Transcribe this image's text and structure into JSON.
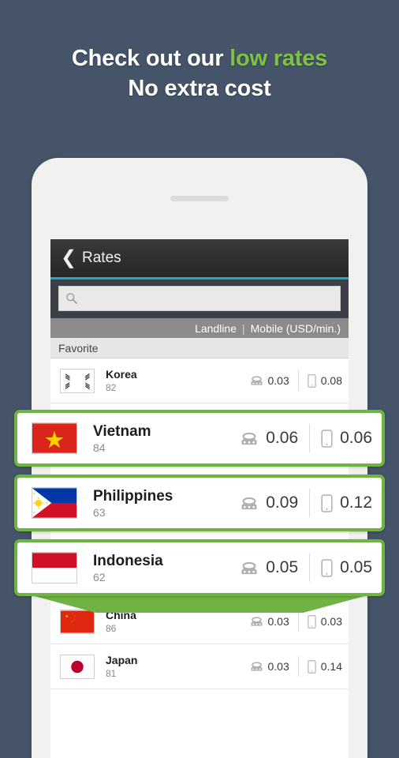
{
  "headline": {
    "line1_prefix": "Check out our ",
    "line1_accent": "low rates",
    "line2": "No extra cost",
    "accent_color": "#7dc242"
  },
  "app": {
    "back_icon": "back-chevron-icon",
    "title": "Rates",
    "accent_bar_color": "#1fa9c4",
    "search": {
      "icon": "search-icon",
      "value": "",
      "placeholder": ""
    },
    "columns": {
      "landline": "Landline",
      "separator": "|",
      "mobile": "Mobile (USD/min.)"
    },
    "section_title": "Favorite"
  },
  "rows": [
    {
      "country": "Korea",
      "code": "82",
      "landline": "0.03",
      "mobile": "0.08",
      "flag": "kr",
      "highlighted": false
    },
    {
      "country": "China",
      "code": "86",
      "landline": "0.03",
      "mobile": "0.03",
      "flag": "cn",
      "highlighted": false
    },
    {
      "country": "Japan",
      "code": "81",
      "landline": "0.03",
      "mobile": "0.14",
      "flag": "jp",
      "highlighted": false
    }
  ],
  "highlighted_rows": [
    {
      "country": "Vietnam",
      "code": "84",
      "landline": "0.06",
      "mobile": "0.06",
      "flag": "vn"
    },
    {
      "country": "Philippines",
      "code": "63",
      "landline": "0.09",
      "mobile": "0.12",
      "flag": "ph"
    },
    {
      "country": "Indonesia",
      "code": "62",
      "landline": "0.05",
      "mobile": "0.05",
      "flag": "id"
    }
  ],
  "icons": {
    "landline": "landline-phone-icon",
    "mobile": "mobile-phone-icon"
  },
  "colors": {
    "background": "#455468",
    "highlight_green": "#6fb344",
    "cyan": "#1fa9c4"
  }
}
